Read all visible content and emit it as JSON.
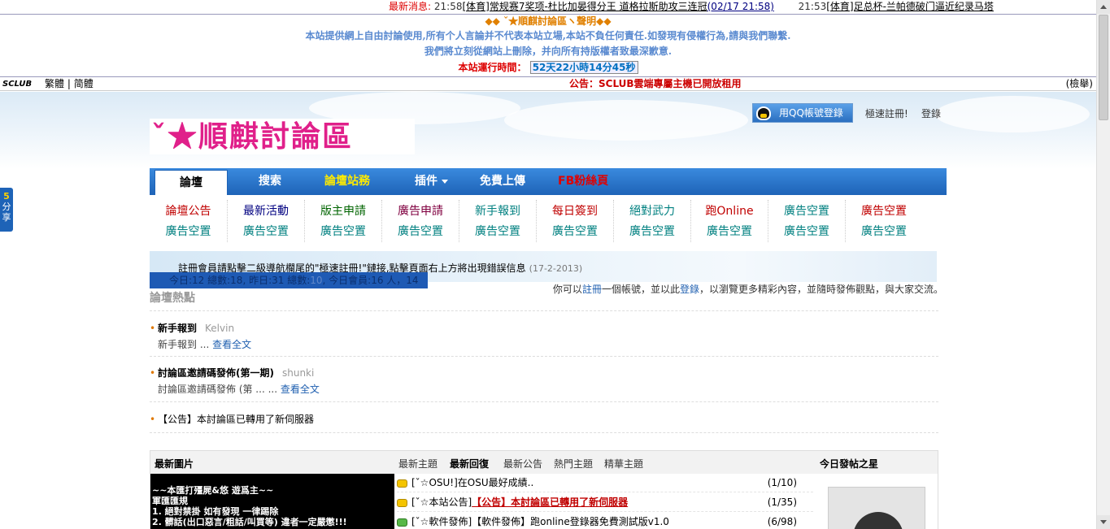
{
  "ticker": {
    "label": "最新消息:",
    "items": [
      {
        "time": "21:58",
        "text": "[体育]常规赛7奖项-杜比加晏得分王 道格拉斯助攻三连冠",
        "date": "(02/17 21:58)"
      },
      {
        "time": "21:53",
        "text": "[体育]足总杯-兰帕德破门逼近纪录马塔"
      }
    ]
  },
  "disclaimer": {
    "title": "◆◆ ˇ★順麒討論區ヽ聲明◆◆",
    "line1": "本站提供網上自由討論使用,所有个人言論并不代表本站立場,本站不負任何責任.如發現有侵權行為,請與我們聯繫.",
    "line2": "我們將立刻從網站上刪除，并向所有持版權者致最深歉意.",
    "runtime_label": "本站運行時間：",
    "runtime_value": "52天22小時14分45秒"
  },
  "sclub": {
    "logo": "SCLUB",
    "trad": "繁體",
    "sep": "|",
    "simp": "简體",
    "notice": "公告：SCLUB雲端專屬主機已開放租用",
    "search": "(檢舉)"
  },
  "header": {
    "logo_text": "ˇ★順麒討論區",
    "qq_login": "用QQ帳號登錄",
    "register": "極速註冊!",
    "login": "登錄"
  },
  "nav": {
    "items": [
      {
        "label": "論壇"
      },
      {
        "label": "搜索"
      },
      {
        "label": "論壇站務"
      },
      {
        "label": "插件"
      },
      {
        "label": "免費上傳"
      },
      {
        "label": "FB粉絲頁"
      }
    ]
  },
  "grid": {
    "columns": [
      {
        "top": "論壇公告",
        "bottom": "廣告空置",
        "color": "#c00000"
      },
      {
        "top": "最新活動",
        "bottom": "廣告空置",
        "color": "#000080"
      },
      {
        "top": "版主申請",
        "bottom": "廣告空置",
        "color": "#006400"
      },
      {
        "top": "廣告申請",
        "bottom": "廣告空置",
        "color": "#800040"
      },
      {
        "top": "新手報到",
        "bottom": "廣告空置",
        "color": "#008080"
      },
      {
        "top": "每日簽到",
        "bottom": "廣告空置",
        "color": "#c00000"
      },
      {
        "top": "絕對武力",
        "bottom": "廣告空置",
        "color": "#008080"
      },
      {
        "top": "跑Online",
        "bottom": "廣告空置",
        "color": "#c00000"
      },
      {
        "top": "廣告空置",
        "bottom": "廣告空置",
        "color": "#008080"
      },
      {
        "top": "廣告空置",
        "bottom": "廣告空置",
        "color": "#c00000"
      }
    ],
    "bottom_color": "#008080"
  },
  "announcement": {
    "text": "註冊會員請點擊二級導航欄尾的\"極速註冊!\"鏈接,點擊頁面右上方將出現錯誤信息",
    "date": "(17-2-2013)"
  },
  "stats": {
    "text": "今日:12 總數:18, 昨日:31 總數:",
    "dim": "10",
    "tail": ", 今日會員:16 人，14"
  },
  "welcome": {
    "pre": "你可以",
    "reg": "註冊",
    "mid": "一個帳號，並以此",
    "login": "登錄",
    "post": "，以瀏覽更多精彩內容，並隨時發佈觀點，與大家交流。"
  },
  "hot": {
    "title": "論壇熱點",
    "items": [
      {
        "title": "新手報到",
        "author": "Kelvin",
        "summary": "新手報到 ... ",
        "more": "查看全文"
      },
      {
        "title": "討論區邀請碼發佈(第一期)",
        "author": "shunki",
        "summary": "討論區邀請碼發佈 (第 ... ... ",
        "more": "查看全文"
      }
    ],
    "notice": "【公告】本討論區已轉用了新伺服器"
  },
  "box": {
    "pic_label": "最新圖片",
    "tabs": [
      "最新主題",
      "最新回復",
      "最新公告",
      "熱門主題",
      "精華主題"
    ],
    "active_tab": "最新回復",
    "star_label": "今日發帖之星",
    "pic_lines": [
      "~~本匯打殭屍&悠 遊爲主~~",
      "軍匯匯規",
      "1. 絕對禁掛  如有發現  一律踢除",
      "2. 髒話(出口惡言/粗話/叫買等) 違者一定嚴懲!!!"
    ],
    "threads": [
      {
        "pre": "[ˇ☆OSU!]在OSU最好成績..",
        "hl": "",
        "count": "(1/10)",
        "icon": "yellow"
      },
      {
        "pre": "[ˇ☆本站公告]",
        "hl": "【公告】本討論區已轉用了新伺服器",
        "count": "(1/35)",
        "icon": "yellow"
      },
      {
        "pre": "[ˇ☆軟件發佈]【軟件發佈】跑online登錄器免費測試版v1.0",
        "hl": "",
        "count": "(6/98)",
        "icon": "green"
      }
    ]
  },
  "share": {
    "badge": "5",
    "label": "分享"
  }
}
